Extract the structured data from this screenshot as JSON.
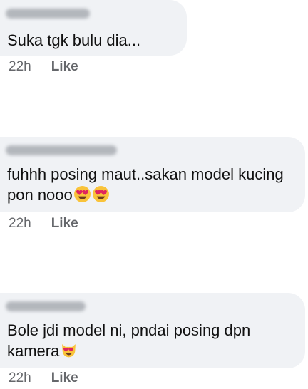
{
  "comments": [
    {
      "text": "Suka tgk bulu dia...",
      "time": "22h",
      "like_label": "Like",
      "emojis": []
    },
    {
      "text": "fuhhh posing maut..sakan model kucing pon nooo",
      "time": "22h",
      "like_label": "Like",
      "emojis": [
        "heart-eyes-emoji",
        "heart-eyes-emoji"
      ]
    },
    {
      "text": "Bole jdi model ni, pndai posing dpn kamera",
      "time": "22h",
      "like_label": "Like",
      "emojis": [
        "heart-eyes-cat-emoji"
      ]
    }
  ],
  "colors": {
    "bubble": "#f0f2f5",
    "text": "#111111",
    "meta": "#65676b",
    "emoji_face": "#f9c33a",
    "emoji_heart": "#e0245e"
  }
}
